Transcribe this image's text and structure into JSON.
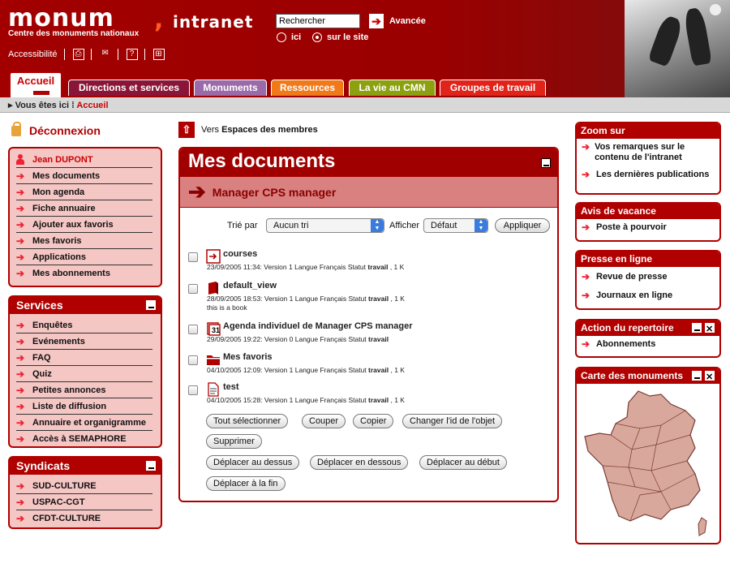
{
  "header": {
    "logo_text": "monum",
    "logo_suffix": "intranet",
    "subtitle": "Centre des monuments nationaux",
    "accessibility": "Accessibilité",
    "tool_icons": [
      "print-icon",
      "mail-icon",
      "help-icon",
      "sitemap-icon"
    ],
    "search": {
      "value": "Rechercher",
      "advanced": "Avancée",
      "scope_here": "ici",
      "scope_site": "sur le site",
      "selected_scope": "sur le site"
    }
  },
  "tabs": [
    {
      "label": "Accueil",
      "color": "#ffffff"
    },
    {
      "label": "Directions et services",
      "color": "#8a1538"
    },
    {
      "label": "Monuments",
      "color": "#9b6aa8"
    },
    {
      "label": "Ressources",
      "color": "#f07a1a"
    },
    {
      "label": "La vie au CMN",
      "color": "#8ca010"
    },
    {
      "label": "Groupes de travail",
      "color": "#e2231a"
    }
  ],
  "breadcrumb": {
    "prefix": "Vous êtes ici",
    "current": "Accueil"
  },
  "logout": "Déconnexion",
  "user_box": {
    "user": "Jean DUPONT",
    "items": [
      "Mes documents",
      "Mon agenda",
      "Fiche annuaire",
      "Ajouter aux favoris",
      "Mes favoris",
      "Applications",
      "Mes abonnements"
    ]
  },
  "services": {
    "title": "Services",
    "items": [
      "Enquêtes",
      "Evénements",
      "FAQ",
      "Quiz",
      "Petites annonces",
      "Liste de diffusion",
      "Annuaire et organigramme",
      "Accès à SEMAPHORE"
    ]
  },
  "syndicats": {
    "title": "Syndicats",
    "items": [
      "SUD-CULTURE",
      "USPAC-CGT",
      "CFDT-CULTURE"
    ]
  },
  "main": {
    "back_prefix": "Vers",
    "back_target": "Espaces des membres",
    "title": "Mes documents",
    "subtitle": "Manager CPS manager",
    "sort_label": "Trié par",
    "sort_value": "Aucun tri",
    "show_label": "Afficher",
    "show_value": "Défaut",
    "apply": "Appliquer",
    "docs": [
      {
        "name": "courses",
        "date": "23/09/2005 11:34:",
        "version": "Version 1",
        "lang": "Langue Français",
        "status_label": "Statut",
        "status": "travail",
        "size": ", 1 K",
        "desc": "",
        "icon": "link-icon"
      },
      {
        "name": "default_view",
        "date": "28/09/2005 18:53:",
        "version": "Version 1",
        "lang": "Langue Français",
        "status_label": "Statut",
        "status": "travail",
        "size": ", 1 K",
        "desc": "this is a book",
        "icon": "book-icon"
      },
      {
        "name": "Agenda individuel de Manager CPS manager",
        "date": "29/09/2005 19:22:",
        "version": "Version 0",
        "lang": "Langue Français",
        "status_label": "Statut",
        "status": "travail",
        "size": "",
        "desc": "",
        "icon": "calendar-icon"
      },
      {
        "name": "Mes favoris",
        "date": "04/10/2005 12:09:",
        "version": "Version 1",
        "lang": "Langue Français",
        "status_label": "Statut",
        "status": "travail",
        "size": ", 1 K",
        "desc": "",
        "icon": "folder-icon"
      },
      {
        "name": "test",
        "date": "04/10/2005 15:28:",
        "version": "Version 1",
        "lang": "Langue Français",
        "status_label": "Statut",
        "status": "travail",
        "size": ", 1 K",
        "desc": "",
        "icon": "document-icon"
      }
    ],
    "actions": [
      "Tout sélectionner",
      "Couper",
      "Copier",
      "Changer l'id de l'objet",
      "Supprimer",
      "Déplacer au dessus",
      "Déplacer en dessous",
      "Déplacer au début",
      "Déplacer à la fin"
    ]
  },
  "right": {
    "zoom": {
      "title": "Zoom sur",
      "items": [
        "Vos remarques sur le contenu de l'intranet",
        "Les dernières publications"
      ]
    },
    "vacance": {
      "title": "Avis de vacance",
      "items": [
        "Poste à pourvoir"
      ]
    },
    "presse": {
      "title": "Presse en ligne",
      "items": [
        "Revue de presse",
        "Journaux en ligne"
      ]
    },
    "action": {
      "title": "Action du repertoire",
      "items": [
        "Abonnements"
      ]
    },
    "carte": {
      "title": "Carte des monuments"
    }
  }
}
